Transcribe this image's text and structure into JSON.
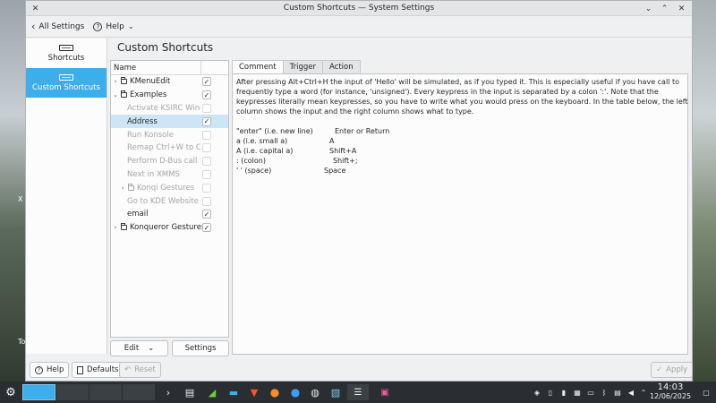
{
  "window": {
    "title": "Custom Shortcuts — System Settings"
  },
  "toolbar": {
    "back_label": "All Settings",
    "help_label": "Help"
  },
  "sidebar": {
    "items": [
      {
        "label": "Shortcuts"
      },
      {
        "label": "Custom Shortcuts"
      }
    ]
  },
  "page": {
    "title": "Custom Shortcuts"
  },
  "tree": {
    "header": "Name",
    "rows": [
      {
        "label": "KMenuEdit"
      },
      {
        "label": "Examples"
      },
      {
        "label": "Activate KSIRC Wind..."
      },
      {
        "label": "Address"
      },
      {
        "label": "Run Konsole"
      },
      {
        "label": "Remap Ctrl+W to Ct..."
      },
      {
        "label": "Perform D-Bus call '..."
      },
      {
        "label": "Next in XMMS"
      },
      {
        "label": "Konqi Gestures"
      },
      {
        "label": "Go to KDE Website"
      },
      {
        "label": "email"
      },
      {
        "label": "Konqueror Gestures"
      }
    ],
    "edit_label": "Edit",
    "settings_label": "Settings"
  },
  "tabs": [
    {
      "label": "Comment"
    },
    {
      "label": "Trigger"
    },
    {
      "label": "Action"
    }
  ],
  "comment": {
    "paragraph": "After pressing Alt+Ctrl+H the input of 'Hello' will be simulated, as if you typed it.  This is especially useful if you have call to frequently type a word (for instance, 'unsigned').  Every keypress in the input is separated by a colon ':'. Note that the keypresses literally mean keypresses, so you have to write what you would press on the keyboard. In the table below, the left column shows the input and the right column shows what to type.",
    "table": [
      {
        "input": "\"enter\" (i.e. new line)",
        "keys": "Enter or Return"
      },
      {
        "input": "a (i.e. small a)",
        "keys": "A"
      },
      {
        "input": "A (i.e. capital a)",
        "keys": "Shift+A"
      },
      {
        "input": ": (colon)",
        "keys": "Shift+;"
      },
      {
        "input": "' '  (space)",
        "keys": "Space"
      }
    ]
  },
  "bottom": {
    "help_label": "Help",
    "defaults_label": "Defaults",
    "reset_label": "Reset",
    "apply_label": "Apply"
  },
  "clock": {
    "time": "14:03",
    "date": "12/06/2025"
  },
  "desktop": {
    "left_labels": [
      "X",
      "To"
    ]
  }
}
